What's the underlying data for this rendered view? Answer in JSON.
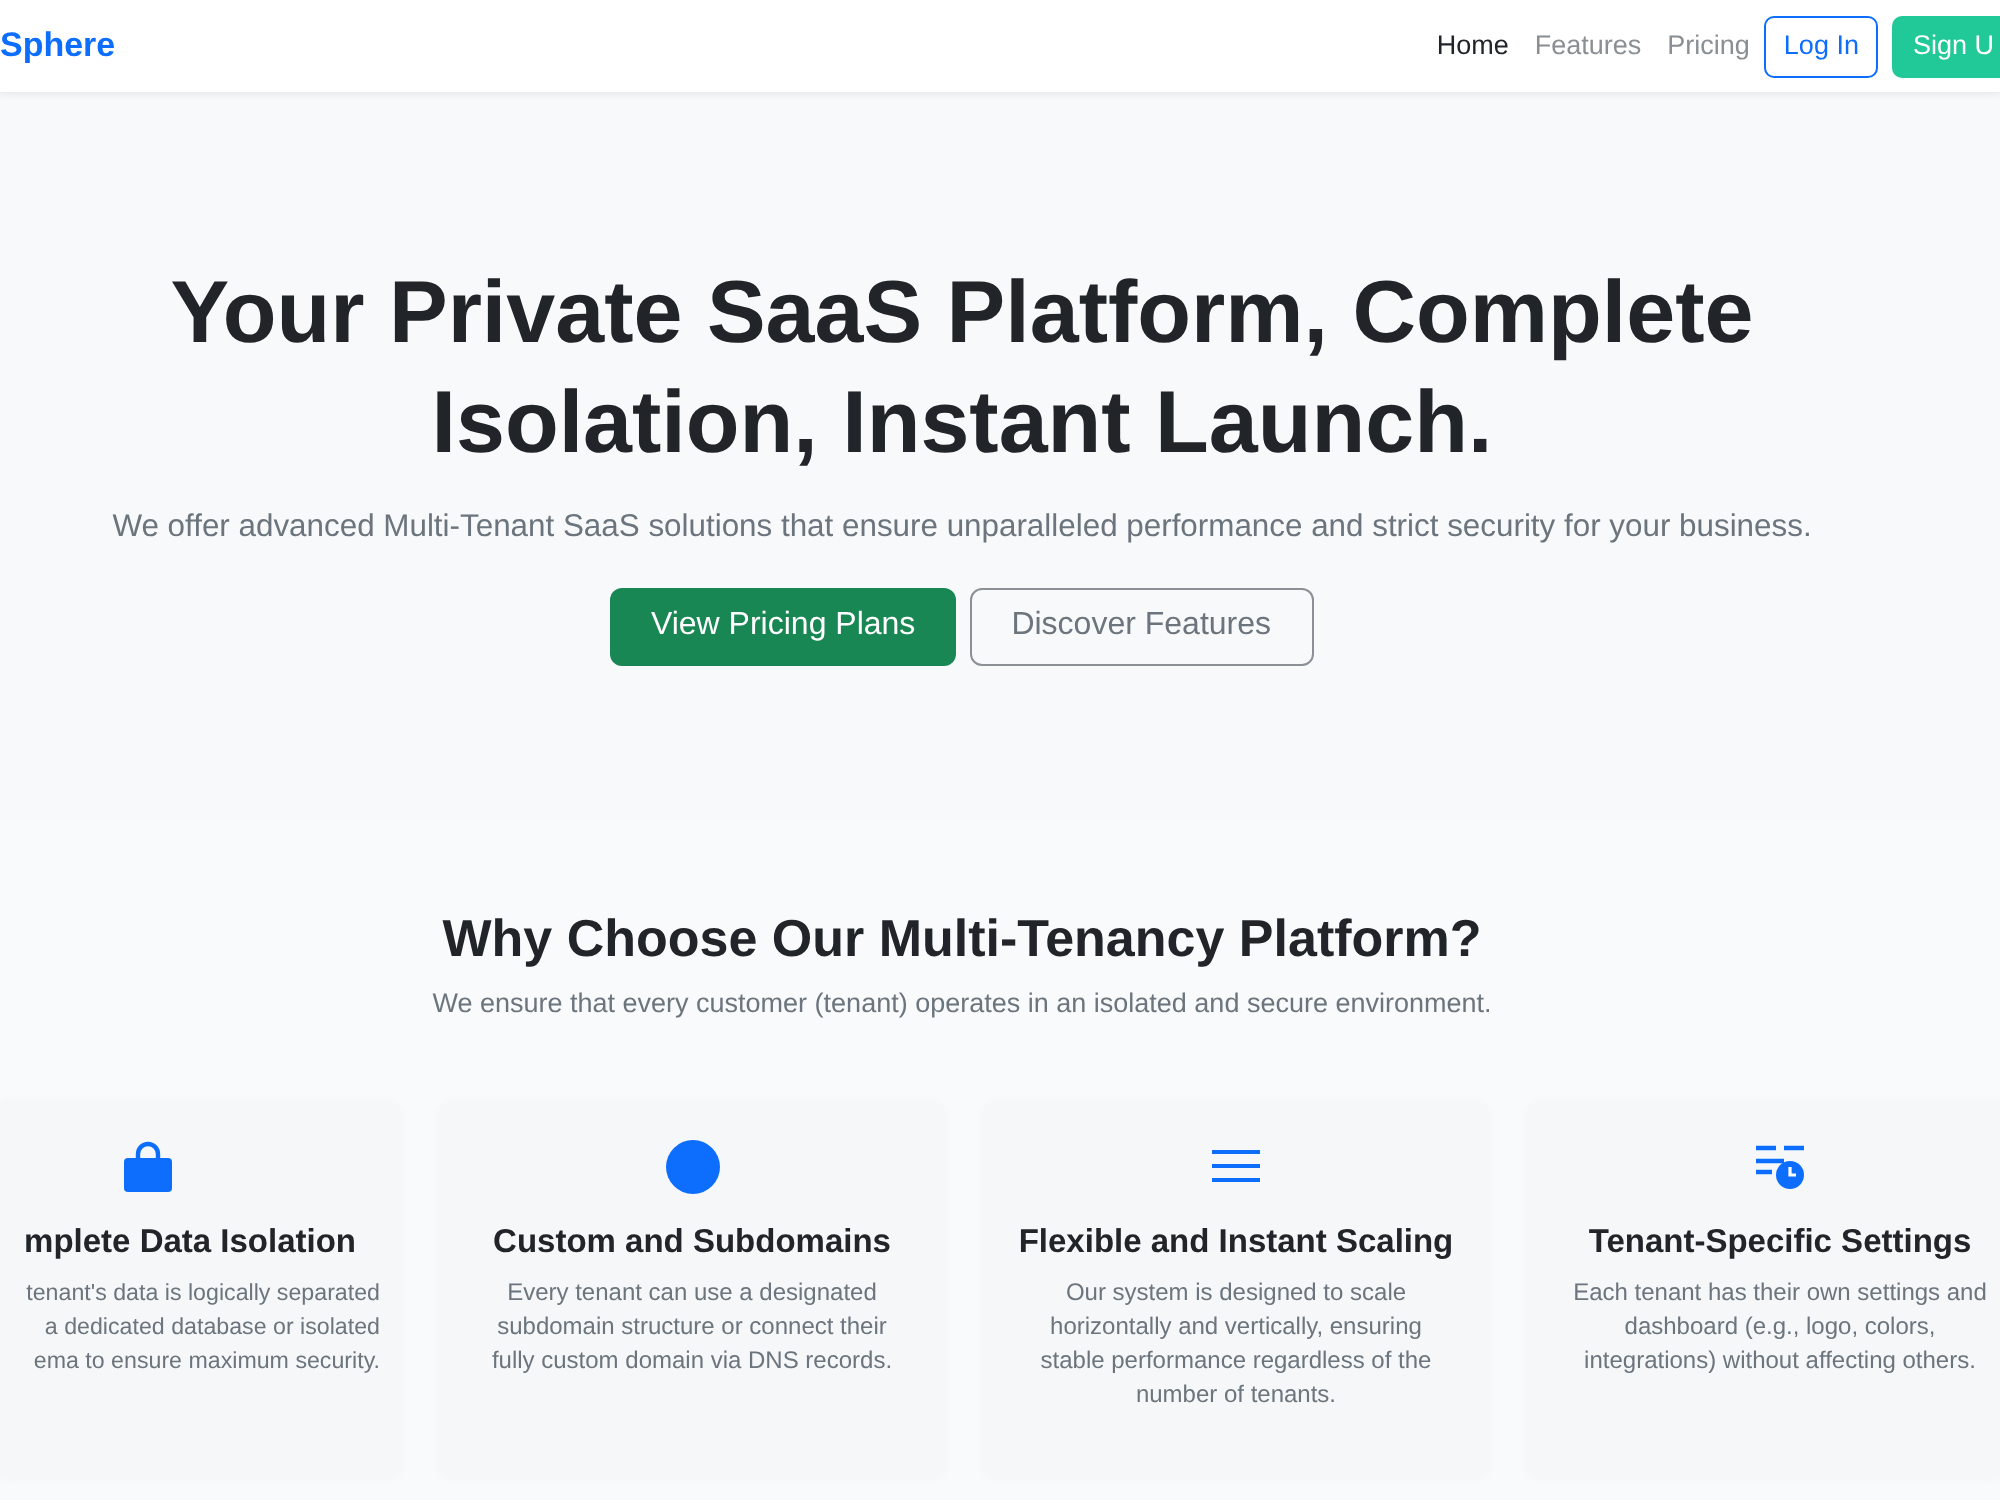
{
  "navbar": {
    "brand": "Sphere",
    "links": [
      {
        "label": "Home",
        "selected": true
      },
      {
        "label": "Features",
        "selected": false
      },
      {
        "label": "Pricing",
        "selected": false
      }
    ],
    "buttons": [
      {
        "label": "Log In",
        "kind": "outline"
      },
      {
        "label": "Sign U",
        "kind": "solid"
      }
    ]
  },
  "hero": {
    "title": "Your Private SaaS Platform, Complete Isolation, Instant Launch.",
    "subtitle": "We offer advanced Multi-Tenant SaaS solutions that ensure unparalleled performance and strict security for your business.",
    "buttons": [
      {
        "label": "View Pricing Plans",
        "kind": "solid"
      },
      {
        "label": "Discover Features",
        "kind": "outline"
      }
    ]
  },
  "features": {
    "title": "Why Choose Our Multi-Tenancy Platform?",
    "subtitle": "We ensure that every customer (tenant) operates in an isolated and secure environment.",
    "cards": [
      {
        "title": "mplete Data Isolation",
        "lines": [
          "tenant's data is logically separated",
          "a dedicated database or isolated",
          "ema to ensure maximum security."
        ]
      },
      {
        "title": "Custom and Subdomains",
        "lines": [
          "Every tenant can use a designated",
          "subdomain structure or connect their",
          "fully custom domain via DNS records."
        ]
      },
      {
        "title": "Flexible and Instant Scaling",
        "lines": [
          "Our system is designed to scale",
          "horizontally and vertically, ensuring",
          "stable performance regardless of the",
          "number of tenants."
        ]
      },
      {
        "title": "Tenant-Specific Settings",
        "lines": [
          "Each tenant has their own settings and",
          "dashboard (e.g., logo, colors,",
          "integrations) without affecting others."
        ]
      }
    ]
  }
}
